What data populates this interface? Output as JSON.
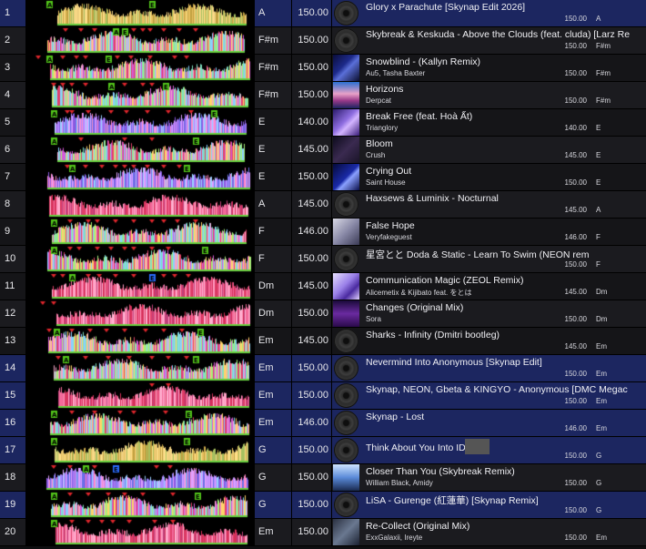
{
  "colors": {
    "selected_row": "#1c2660",
    "row_dark": "#151518",
    "row_base": "#1b1b1f",
    "cue_red": "#e0262c",
    "cue_green": "#52c41a",
    "cue_blue": "#2a6cff"
  },
  "tracks": [
    {
      "num": "1",
      "key": "A",
      "bpm": "150.00",
      "title": "Glory x Parachute [Skynap Edit 2026]",
      "artist": "",
      "info_bpm": "150.00",
      "info_key": "A",
      "art": "disc",
      "selected": true,
      "cues": [
        {
          "t": "A",
          "p": 0.1,
          "c": "g"
        },
        {
          "t": "E",
          "p": 0.55,
          "c": "g"
        }
      ],
      "seed": 11,
      "style": "gold"
    },
    {
      "num": "2",
      "key": "F#m",
      "bpm": "150.00",
      "title": "Skybreak & Keskuda - Above the Clouds (feat. cluda) [Larz Re",
      "artist": "",
      "info_bpm": "150.00",
      "info_key": "F#m",
      "art": "disc",
      "selected": false,
      "cues": [
        {
          "t": "",
          "p": 0.17,
          "c": "r"
        },
        {
          "t": "",
          "p": 0.24,
          "c": "r"
        },
        {
          "t": "",
          "p": 0.3,
          "c": "r"
        },
        {
          "t": "A",
          "p": 0.39,
          "c": "g"
        },
        {
          "t": "E",
          "p": 0.43,
          "c": "g"
        },
        {
          "t": "",
          "p": 0.47,
          "c": "r"
        },
        {
          "t": "",
          "p": 0.51,
          "c": "r"
        },
        {
          "t": "",
          "p": 0.54,
          "c": "r"
        },
        {
          "t": "",
          "p": 0.6,
          "c": "r"
        },
        {
          "t": "",
          "p": 0.67,
          "c": "r"
        },
        {
          "t": "",
          "p": 0.74,
          "c": "r"
        }
      ],
      "seed": 22,
      "style": "rainbow"
    },
    {
      "num": "3",
      "key": "F#m",
      "bpm": "150.00",
      "title": "Snowblind - (Kallyn Remix)",
      "artist": "Au5, Tasha Baxter",
      "info_bpm": "150.00",
      "info_key": "F#m",
      "art": "blue",
      "selected": false,
      "cues": [
        {
          "t": "",
          "p": 0.05,
          "c": "r"
        },
        {
          "t": "A",
          "p": 0.1,
          "c": "g"
        },
        {
          "t": "",
          "p": 0.16,
          "c": "r"
        },
        {
          "t": "",
          "p": 0.22,
          "c": "r"
        },
        {
          "t": "",
          "p": 0.26,
          "c": "r"
        },
        {
          "t": "E",
          "p": 0.36,
          "c": "g"
        },
        {
          "t": "",
          "p": 0.4,
          "c": "r"
        },
        {
          "t": "",
          "p": 0.46,
          "c": "r"
        },
        {
          "t": "",
          "p": 0.54,
          "c": "r"
        },
        {
          "t": "",
          "p": 0.65,
          "c": "r"
        },
        {
          "t": "",
          "p": 0.7,
          "c": "r"
        }
      ],
      "seed": 33,
      "style": "rainbow"
    },
    {
      "num": "4",
      "key": "F#m",
      "bpm": "150.00",
      "title": "Horizons",
      "artist": "Derpcat",
      "info_bpm": "150.00",
      "info_key": "F#m",
      "art": "horizon",
      "selected": false,
      "cues": [
        {
          "t": "",
          "p": 0.12,
          "c": "r"
        },
        {
          "t": "",
          "p": 0.16,
          "c": "r"
        },
        {
          "t": "",
          "p": 0.2,
          "c": "r"
        },
        {
          "t": "",
          "p": 0.26,
          "c": "r"
        },
        {
          "t": "A",
          "p": 0.37,
          "c": "g"
        },
        {
          "t": "",
          "p": 0.43,
          "c": "r"
        },
        {
          "t": "",
          "p": 0.51,
          "c": "r"
        },
        {
          "t": "",
          "p": 0.55,
          "c": "r"
        },
        {
          "t": "E",
          "p": 0.61,
          "c": "g"
        }
      ],
      "seed": 44,
      "style": "rainbow"
    },
    {
      "num": "5",
      "key": "E",
      "bpm": "140.00",
      "title": "Break Free (feat. Hoà Ất)",
      "artist": "Trianglory",
      "info_bpm": "140.00",
      "info_key": "E",
      "art": "purple",
      "selected": false,
      "cues": [
        {
          "t": "A",
          "p": 0.12,
          "c": "g"
        },
        {
          "t": "",
          "p": 0.18,
          "c": "r"
        },
        {
          "t": "",
          "p": 0.2,
          "c": "r"
        },
        {
          "t": "",
          "p": 0.27,
          "c": "r"
        },
        {
          "t": "",
          "p": 0.37,
          "c": "r"
        },
        {
          "t": "",
          "p": 0.44,
          "c": "r"
        },
        {
          "t": "",
          "p": 0.53,
          "c": "r"
        },
        {
          "t": "",
          "p": 0.62,
          "c": "r"
        },
        {
          "t": "",
          "p": 0.72,
          "c": "r"
        },
        {
          "t": "E",
          "p": 0.82,
          "c": "g"
        }
      ],
      "seed": 55,
      "style": "purple"
    },
    {
      "num": "6",
      "key": "E",
      "bpm": "145.00",
      "title": "Bloom",
      "artist": "Crush",
      "info_bpm": "145.00",
      "info_key": "E",
      "art": "dark",
      "selected": false,
      "cues": [
        {
          "t": "A",
          "p": 0.12,
          "c": "g"
        },
        {
          "t": "",
          "p": 0.24,
          "c": "r"
        },
        {
          "t": "",
          "p": 0.43,
          "c": "r"
        },
        {
          "t": "",
          "p": 0.55,
          "c": "r"
        },
        {
          "t": "E",
          "p": 0.74,
          "c": "g"
        }
      ],
      "seed": 66,
      "style": "rainbow"
    },
    {
      "num": "7",
      "key": "E",
      "bpm": "150.00",
      "title": "Crying Out",
      "artist": "Saint House",
      "info_bpm": "150.00",
      "info_key": "E",
      "art": "navy",
      "selected": false,
      "cues": [
        {
          "t": "",
          "p": 0.18,
          "c": "r"
        },
        {
          "t": "A",
          "p": 0.2,
          "c": "g"
        },
        {
          "t": "",
          "p": 0.26,
          "c": "r"
        },
        {
          "t": "",
          "p": 0.33,
          "c": "r"
        },
        {
          "t": "",
          "p": 0.39,
          "c": "r"
        },
        {
          "t": "",
          "p": 0.43,
          "c": "r"
        },
        {
          "t": "",
          "p": 0.47,
          "c": "r"
        },
        {
          "t": "",
          "p": 0.53,
          "c": "r"
        },
        {
          "t": "",
          "p": 0.6,
          "c": "r"
        },
        {
          "t": "",
          "p": 0.67,
          "c": "r"
        },
        {
          "t": "E",
          "p": 0.7,
          "c": "g"
        }
      ],
      "seed": 77,
      "style": "purple"
    },
    {
      "num": "8",
      "key": "A",
      "bpm": "145.00",
      "title": "Haxsews & Luminix - Nocturnal",
      "artist": "",
      "info_bpm": "145.00",
      "info_key": "A",
      "art": "disc",
      "selected": false,
      "cues": [],
      "seed": 88,
      "style": "pink"
    },
    {
      "num": "9",
      "key": "F",
      "bpm": "146.00",
      "title": "False Hope",
      "artist": "Veryfakeguest",
      "info_bpm": "146.00",
      "info_key": "F",
      "art": "sketch",
      "selected": false,
      "cues": [
        {
          "t": "A",
          "p": 0.12,
          "c": "g"
        },
        {
          "t": "",
          "p": 0.19,
          "c": "r"
        },
        {
          "t": "",
          "p": 0.27,
          "c": "r"
        },
        {
          "t": "",
          "p": 0.31,
          "c": "r"
        },
        {
          "t": "",
          "p": 0.39,
          "c": "r"
        },
        {
          "t": "",
          "p": 0.47,
          "c": "r"
        },
        {
          "t": "",
          "p": 0.55,
          "c": "r"
        },
        {
          "t": "",
          "p": 0.6,
          "c": "r"
        },
        {
          "t": "",
          "p": 0.66,
          "c": "r"
        },
        {
          "t": "",
          "p": 0.74,
          "c": "r"
        }
      ],
      "seed": 99,
      "style": "rainbow"
    },
    {
      "num": "10",
      "key": "F",
      "bpm": "150.00",
      "title": "星宮とと Doda & Static - Learn To Swim (NEON rem",
      "artist": "",
      "info_bpm": "150.00",
      "info_key": "F",
      "art": "disc",
      "selected": false,
      "cues": [
        {
          "t": "A",
          "p": 0.12,
          "c": "g"
        },
        {
          "t": "",
          "p": 0.19,
          "c": "r"
        },
        {
          "t": "",
          "p": 0.23,
          "c": "r"
        },
        {
          "t": "",
          "p": 0.31,
          "c": "r"
        },
        {
          "t": "",
          "p": 0.37,
          "c": "r"
        },
        {
          "t": "",
          "p": 0.43,
          "c": "r"
        },
        {
          "t": "",
          "p": 0.47,
          "c": "r"
        },
        {
          "t": "",
          "p": 0.55,
          "c": "r"
        },
        {
          "t": "",
          "p": 0.62,
          "c": "r"
        },
        {
          "t": "E",
          "p": 0.78,
          "c": "g"
        }
      ],
      "seed": 101,
      "style": "rainbow"
    },
    {
      "num": "11",
      "key": "Dm",
      "bpm": "145.00",
      "title": "Communication Magic (ZEOL Remix)",
      "artist": "Alicemetix & Kijibato feat. をとは",
      "info_bpm": "145.00",
      "info_key": "Dm",
      "art": "anime",
      "selected": false,
      "cues": [
        {
          "t": "",
          "p": 0.12,
          "c": "r"
        },
        {
          "t": "",
          "p": 0.16,
          "c": "r"
        },
        {
          "t": "A",
          "p": 0.2,
          "c": "g"
        },
        {
          "t": "",
          "p": 0.27,
          "c": "r"
        },
        {
          "t": "",
          "p": 0.32,
          "c": "r"
        },
        {
          "t": "",
          "p": 0.39,
          "c": "r"
        },
        {
          "t": "",
          "p": 0.47,
          "c": "r"
        },
        {
          "t": "E",
          "p": 0.55,
          "c": "b"
        },
        {
          "t": "",
          "p": 0.6,
          "c": "r"
        },
        {
          "t": "",
          "p": 0.65,
          "c": "r"
        },
        {
          "t": "",
          "p": 0.71,
          "c": "r"
        }
      ],
      "seed": 111,
      "style": "pink"
    },
    {
      "num": "12",
      "key": "Dm",
      "bpm": "150.00",
      "title": "Changes (Original Mix)",
      "artist": "Sora",
      "info_bpm": "150.00",
      "info_key": "Dm",
      "art": "violet",
      "selected": false,
      "cues": [
        {
          "t": "",
          "p": 0.07,
          "c": "r"
        },
        {
          "t": "",
          "p": 0.12,
          "c": "r"
        }
      ],
      "seed": 121,
      "style": "pink"
    },
    {
      "num": "13",
      "key": "Em",
      "bpm": "145.00",
      "title": "Sharks - Infinity (Dmitri bootleg)",
      "artist": "",
      "info_bpm": "145.00",
      "info_key": "Em",
      "art": "disc",
      "selected": false,
      "cues": [
        {
          "t": "",
          "p": 0.1,
          "c": "r"
        },
        {
          "t": "A",
          "p": 0.13,
          "c": "g"
        },
        {
          "t": "",
          "p": 0.2,
          "c": "r"
        },
        {
          "t": "",
          "p": 0.28,
          "c": "r"
        },
        {
          "t": "",
          "p": 0.35,
          "c": "r"
        },
        {
          "t": "",
          "p": 0.43,
          "c": "r"
        },
        {
          "t": "",
          "p": 0.52,
          "c": "r"
        },
        {
          "t": "",
          "p": 0.6,
          "c": "r"
        },
        {
          "t": "",
          "p": 0.68,
          "c": "r"
        },
        {
          "t": "E",
          "p": 0.76,
          "c": "g"
        }
      ],
      "seed": 131,
      "style": "rainbow"
    },
    {
      "num": "14",
      "key": "Em",
      "bpm": "150.00",
      "title": "Nevermind Into Anonymous [Skynap Edit]",
      "artist": "",
      "info_bpm": "150.00",
      "info_key": "Em",
      "art": "disc",
      "selected": true,
      "cues": [
        {
          "t": "",
          "p": 0.14,
          "c": "r"
        },
        {
          "t": "A",
          "p": 0.17,
          "c": "g"
        },
        {
          "t": "",
          "p": 0.26,
          "c": "r"
        },
        {
          "t": "",
          "p": 0.36,
          "c": "r"
        },
        {
          "t": "",
          "p": 0.45,
          "c": "r"
        },
        {
          "t": "",
          "p": 0.55,
          "c": "r"
        },
        {
          "t": "",
          "p": 0.62,
          "c": "r"
        },
        {
          "t": "",
          "p": 0.7,
          "c": "r"
        },
        {
          "t": "E",
          "p": 0.74,
          "c": "g"
        }
      ],
      "seed": 141,
      "style": "rainbow"
    },
    {
      "num": "15",
      "key": "Em",
      "bpm": "150.00",
      "title": "Skynap, NEON, Gbeta & KINGYO - Anonymous [DMC Megac",
      "artist": "",
      "info_bpm": "150.00",
      "info_key": "Em",
      "art": "disc",
      "selected": true,
      "cues": [
        {
          "t": "",
          "p": 0.55,
          "c": "r"
        },
        {
          "t": "",
          "p": 0.62,
          "c": "r"
        }
      ],
      "seed": 151,
      "style": "pink"
    },
    {
      "num": "16",
      "key": "Em",
      "bpm": "146.00",
      "title": "Skynap - Lost",
      "artist": "",
      "info_bpm": "146.00",
      "info_key": "Em",
      "art": "disc",
      "selected": true,
      "cues": [
        {
          "t": "A",
          "p": 0.12,
          "c": "g"
        },
        {
          "t": "",
          "p": 0.2,
          "c": "r"
        },
        {
          "t": "",
          "p": 0.3,
          "c": "r"
        },
        {
          "t": "",
          "p": 0.41,
          "c": "r"
        },
        {
          "t": "",
          "p": 0.47,
          "c": "r"
        },
        {
          "t": "",
          "p": 0.61,
          "c": "r"
        },
        {
          "t": "E",
          "p": 0.71,
          "c": "g"
        }
      ],
      "seed": 161,
      "style": "rainbow"
    },
    {
      "num": "17",
      "key": "G",
      "bpm": "150.00",
      "title": "Think About You Into ID",
      "artist": "",
      "info_bpm": "150.00",
      "info_key": "G",
      "art": "disc",
      "selected": true,
      "cues": [
        {
          "t": "A",
          "p": 0.12,
          "c": "g"
        },
        {
          "t": "E",
          "p": 0.7,
          "c": "g"
        }
      ],
      "seed": 171,
      "style": "gold",
      "redacted": true
    },
    {
      "num": "18",
      "key": "G",
      "bpm": "150.00",
      "title": "Closer Than You (Skybreak Remix)",
      "artist": "William Black, Amidy",
      "info_bpm": "150.00",
      "info_key": "G",
      "art": "sky",
      "selected": false,
      "cues": [
        {
          "t": "",
          "p": 0.12,
          "c": "r"
        },
        {
          "t": "",
          "p": 0.19,
          "c": "r"
        },
        {
          "t": "A",
          "p": 0.26,
          "c": "g"
        },
        {
          "t": "",
          "p": 0.3,
          "c": "r"
        },
        {
          "t": "E",
          "p": 0.39,
          "c": "b"
        },
        {
          "t": "",
          "p": 0.57,
          "c": "r"
        },
        {
          "t": "",
          "p": 0.63,
          "c": "r"
        }
      ],
      "seed": 181,
      "style": "purple"
    },
    {
      "num": "19",
      "key": "G",
      "bpm": "150.00",
      "title": "LiSA - Gurenge (紅蓮華) [Skynap Remix]",
      "artist": "",
      "info_bpm": "150.00",
      "info_key": "G",
      "art": "disc",
      "selected": true,
      "cues": [
        {
          "t": "A",
          "p": 0.12,
          "c": "g"
        },
        {
          "t": "",
          "p": 0.19,
          "c": "r"
        },
        {
          "t": "",
          "p": 0.27,
          "c": "r"
        },
        {
          "t": "",
          "p": 0.36,
          "c": "r"
        },
        {
          "t": "",
          "p": 0.43,
          "c": "r"
        },
        {
          "t": "",
          "p": 0.51,
          "c": "r"
        },
        {
          "t": "",
          "p": 0.64,
          "c": "r"
        },
        {
          "t": "E",
          "p": 0.75,
          "c": "g"
        }
      ],
      "seed": 191,
      "style": "rainbow"
    },
    {
      "num": "20",
      "key": "Em",
      "bpm": "150.00",
      "title": "Re-Collect (Original Mix)",
      "artist": "ExxGalaxii, Ireyte",
      "info_bpm": "150.00",
      "info_key": "Em",
      "art": "grey",
      "selected": false,
      "cues": [
        {
          "t": "A",
          "p": 0.12,
          "c": "g"
        },
        {
          "t": "",
          "p": 0.2,
          "c": "r"
        },
        {
          "t": "",
          "p": 0.27,
          "c": "r"
        },
        {
          "t": "",
          "p": 0.33,
          "c": "r"
        },
        {
          "t": "",
          "p": 0.38,
          "c": "r"
        },
        {
          "t": "",
          "p": 0.45,
          "c": "r"
        },
        {
          "t": "",
          "p": 0.56,
          "c": "r"
        },
        {
          "t": "",
          "p": 0.64,
          "c": "r"
        }
      ],
      "seed": 201,
      "style": "pink"
    }
  ]
}
